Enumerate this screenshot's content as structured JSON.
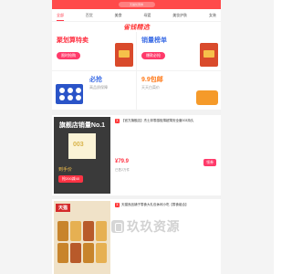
{
  "topbar": {
    "pill_text": "天猫优惠券"
  },
  "tabs": [
    {
      "label": "全部"
    },
    {
      "label": "百货"
    },
    {
      "label": "美食"
    },
    {
      "label": "母婴"
    },
    {
      "label": "美妆护肤"
    },
    {
      "label": "女装"
    }
  ],
  "logo": {
    "text": "省钱精选"
  },
  "promos": [
    {
      "title": "聚划算特卖",
      "button": "限时抢购"
    },
    {
      "title": "销量榜单",
      "button": "爆款必抢"
    },
    {
      "title": "必抢",
      "subtitle": "高品质保障"
    },
    {
      "title": "9.9包邮",
      "subtitle": "天天白菜价"
    }
  ],
  "products": [
    {
      "tag": "天",
      "title": "【官方旗舰店】杰士邦零感极薄超薄安全套003持久",
      "price": "¥79.9",
      "sold": "已售2万件",
      "button": "领券",
      "ad_banner": "旗舰店销量No.1",
      "ad_price": "到手价",
      "ad_button": "抢200减40"
    },
    {
      "tag": "天",
      "title": "天猫良品铺子零食大礼包休闲小吃【零食组合】",
      "price": "",
      "sold": "",
      "button": "",
      "ad_brand": "天猫"
    }
  ],
  "watermark": {
    "text": "玖玖资源"
  },
  "colors": {
    "accent": "#ff3344",
    "topbar": "#ff4a4a",
    "blue": "#3f6fe6",
    "orange": "#ff7a1a"
  }
}
